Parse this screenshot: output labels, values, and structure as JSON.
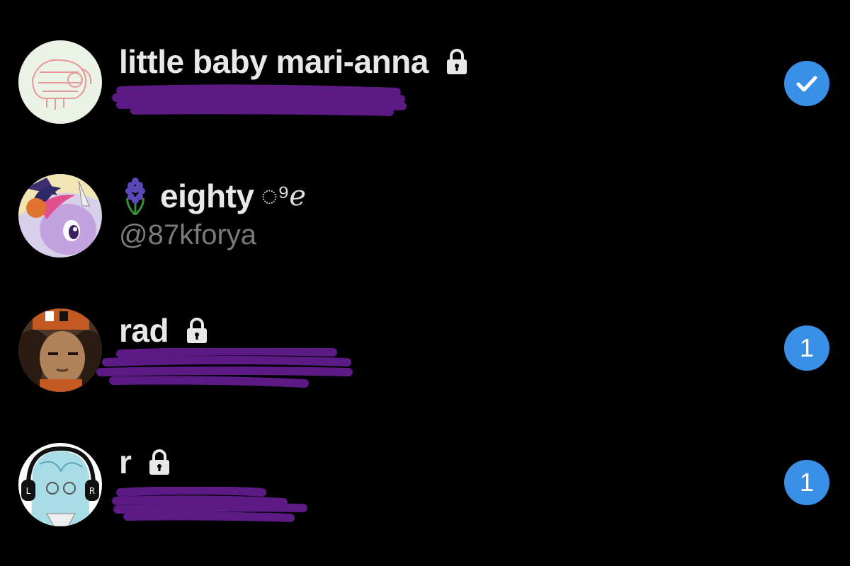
{
  "accounts": [
    {
      "display_name": "little baby mari-anna",
      "protected": true,
      "handle": "",
      "handle_redacted": true,
      "status": "selected"
    },
    {
      "display_name": "eighty",
      "name_suffix": "◌⁹ℯ",
      "emoji": "hyacinth-emoji",
      "protected": false,
      "handle": "@87kforya",
      "handle_redacted": false,
      "status": "none"
    },
    {
      "display_name": "rad",
      "protected": true,
      "handle": "",
      "handle_redacted": true,
      "status": "count",
      "badge_count": "1"
    },
    {
      "display_name": "r",
      "protected": true,
      "handle": "",
      "handle_redacted": true,
      "status": "count",
      "badge_count": "1"
    }
  ],
  "colors": {
    "background": "#000000",
    "name_text": "#e8e8e8",
    "handle_text": "#7a7a7a",
    "badge": "#3a8fe6",
    "redaction": "#5b1a84"
  }
}
